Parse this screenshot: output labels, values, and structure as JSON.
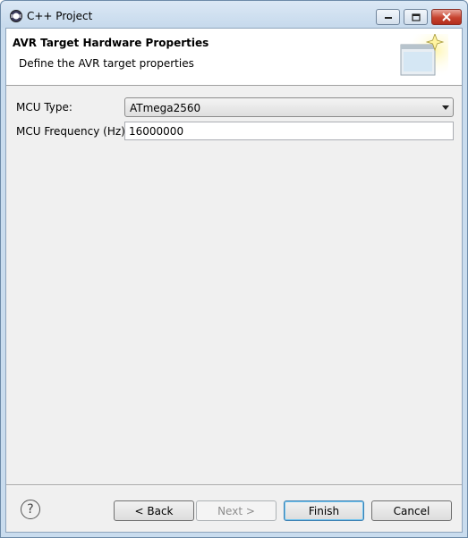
{
  "window": {
    "title": "C++ Project"
  },
  "header": {
    "title": "AVR Target Hardware Properties",
    "description": "Define the AVR target properties"
  },
  "form": {
    "mcu_type_label": "MCU Type:",
    "mcu_type_value": "ATmega2560",
    "mcu_freq_label": "MCU Frequency (Hz):",
    "mcu_freq_value": "16000000"
  },
  "buttons": {
    "help": "?",
    "back": "< Back",
    "next": "Next >",
    "finish": "Finish",
    "cancel": "Cancel"
  }
}
